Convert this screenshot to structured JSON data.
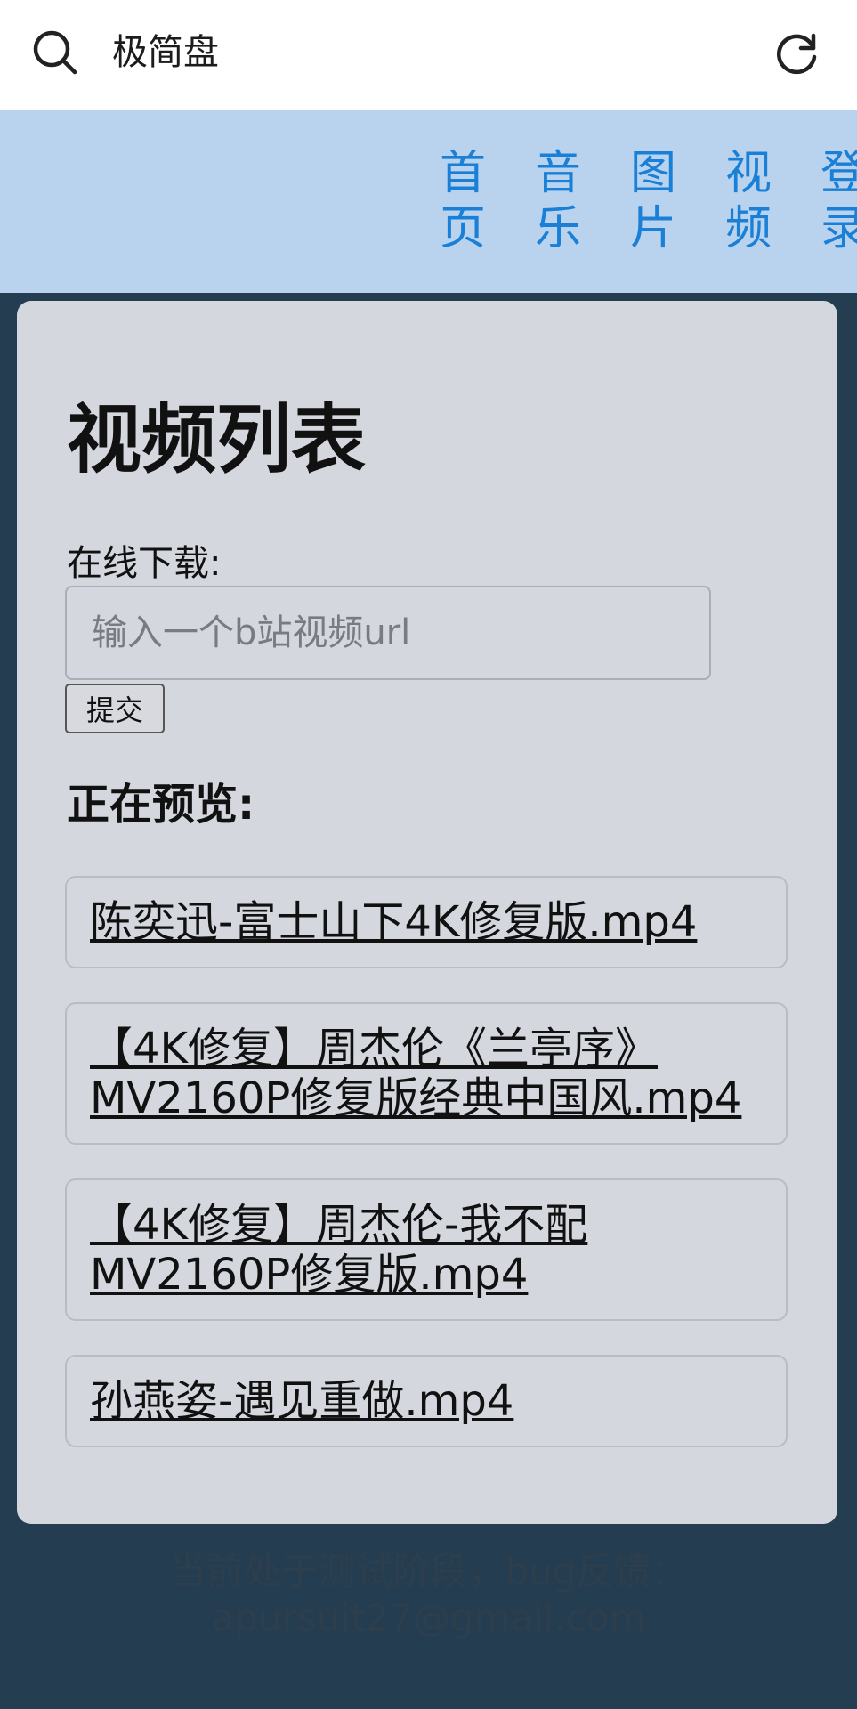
{
  "app": {
    "title": "极简盘",
    "search_icon": "search-icon",
    "refresh_icon": "refresh-icon"
  },
  "nav": {
    "items": [
      {
        "label": "首页"
      },
      {
        "label": "音乐"
      },
      {
        "label": "图片"
      },
      {
        "label": "视频"
      },
      {
        "label": "登录"
      }
    ],
    "color": "#1a7fd6",
    "background": "#b9d3ef"
  },
  "main": {
    "heading": "视频列表",
    "download_label": "在线下载:",
    "url_input": {
      "placeholder": "输入一个b站视频url",
      "value": ""
    },
    "submit_label": "提交",
    "preview_label": "正在预览:",
    "videos": [
      {
        "name": "陈奕迅-富士山下4K修复版.mp4"
      },
      {
        "name": "【4K修复】周杰伦《兰亭序》MV2160P修复版经典中国风.mp4"
      },
      {
        "name": "【4K修复】周杰伦-我不配MV2160P修复版.mp4"
      },
      {
        "name": "孙燕姿-遇见重做.mp4"
      }
    ]
  },
  "footer": {
    "line1": "当前处于测试阶段，bug反馈：",
    "line2": "apursuit27@gmail.com"
  },
  "colors": {
    "page_background": "#253d51",
    "card_background": "#d4d7de"
  }
}
